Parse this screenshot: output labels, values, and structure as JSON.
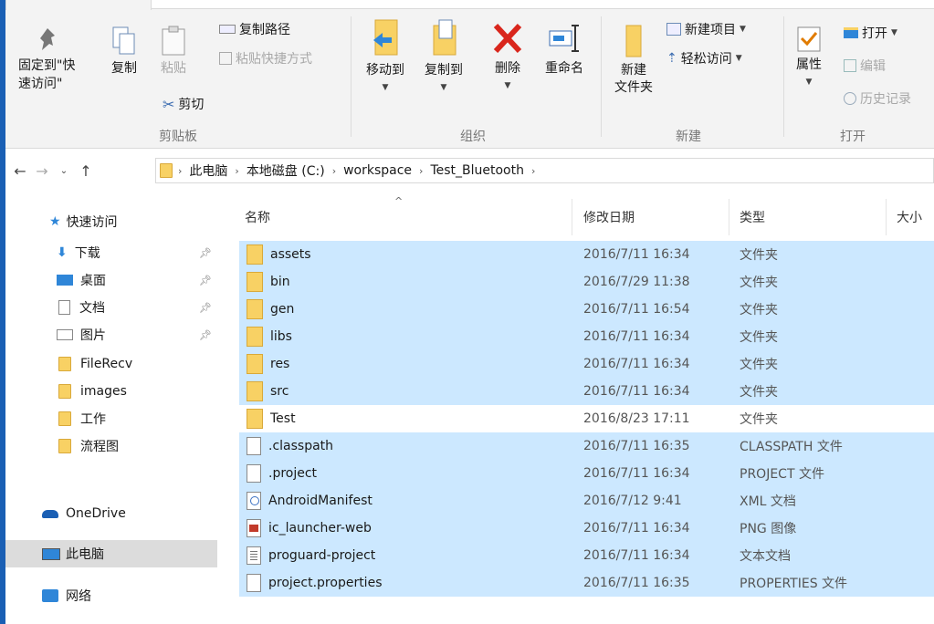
{
  "ribbon": {
    "clipboard": {
      "pin_label": "固定到\"快\n速访问\"",
      "copy_label": "复制",
      "paste_label": "粘贴",
      "copy_path_label": "复制路径",
      "paste_shortcut_label": "粘贴快捷方式",
      "cut_label": "剪切",
      "group_label": "剪贴板"
    },
    "organize": {
      "move_to_label": "移动到",
      "copy_to_label": "复制到",
      "delete_label": "删除",
      "rename_label": "重命名",
      "group_label": "组织"
    },
    "new": {
      "new_folder_label": "新建\n文件夹",
      "new_item_label": "新建项目",
      "easy_access_label": "轻松访问",
      "group_label": "新建"
    },
    "open": {
      "properties_label": "属性",
      "open_label": "打开",
      "edit_label": "编辑",
      "history_label": "历史记录",
      "group_label": "打开"
    }
  },
  "address": {
    "crumbs": [
      "此电脑",
      "本地磁盘 (C:)",
      "workspace",
      "Test_Bluetooth"
    ]
  },
  "nav": {
    "quick_access": "快速访问",
    "items": [
      {
        "label": "下载",
        "pinned": true
      },
      {
        "label": "桌面",
        "pinned": true
      },
      {
        "label": "文档",
        "pinned": true
      },
      {
        "label": "图片",
        "pinned": true
      },
      {
        "label": "FileRecv"
      },
      {
        "label": "images"
      },
      {
        "label": "工作"
      },
      {
        "label": "流程图"
      }
    ],
    "onedrive": "OneDrive",
    "this_pc": "此电脑",
    "network": "网络"
  },
  "columns": {
    "name": "名称",
    "date": "修改日期",
    "type": "类型",
    "size": "大小"
  },
  "files": [
    {
      "name": "assets",
      "date": "2016/7/11 16:34",
      "type": "文件夹",
      "icon": "folder-icon",
      "selected": true
    },
    {
      "name": "bin",
      "date": "2016/7/29 11:38",
      "type": "文件夹",
      "icon": "folder-icon",
      "selected": true
    },
    {
      "name": "gen",
      "date": "2016/7/11 16:54",
      "type": "文件夹",
      "icon": "folder-icon",
      "selected": true
    },
    {
      "name": "libs",
      "date": "2016/7/11 16:34",
      "type": "文件夹",
      "icon": "folder-icon",
      "selected": true
    },
    {
      "name": "res",
      "date": "2016/7/11 16:34",
      "type": "文件夹",
      "icon": "folder-icon",
      "selected": true
    },
    {
      "name": "src",
      "date": "2016/7/11 16:34",
      "type": "文件夹",
      "icon": "folder-icon",
      "selected": true
    },
    {
      "name": "Test",
      "date": "2016/8/23 17:11",
      "type": "文件夹",
      "icon": "folder-icon",
      "selected": false
    },
    {
      "name": ".classpath",
      "date": "2016/7/11 16:35",
      "type": "CLASSPATH 文件",
      "icon": "file-icon",
      "selected": true
    },
    {
      "name": ".project",
      "date": "2016/7/11 16:34",
      "type": "PROJECT 文件",
      "icon": "file-icon",
      "selected": true
    },
    {
      "name": "AndroidManifest",
      "date": "2016/7/12 9:41",
      "type": "XML 文档",
      "icon": "xml-file-icon",
      "selected": true
    },
    {
      "name": "ic_launcher-web",
      "date": "2016/7/11 16:34",
      "type": "PNG 图像",
      "icon": "png-image-icon",
      "selected": true
    },
    {
      "name": "proguard-project",
      "date": "2016/7/11 16:34",
      "type": "文本文档",
      "icon": "text-file-icon",
      "selected": true
    },
    {
      "name": "project.properties",
      "date": "2016/7/11 16:35",
      "type": "PROPERTIES 文件",
      "icon": "file-icon",
      "selected": true
    }
  ],
  "colors": {
    "selection": "#cce8ff",
    "accent": "#1a5fb4",
    "folder": "#f8d164"
  }
}
